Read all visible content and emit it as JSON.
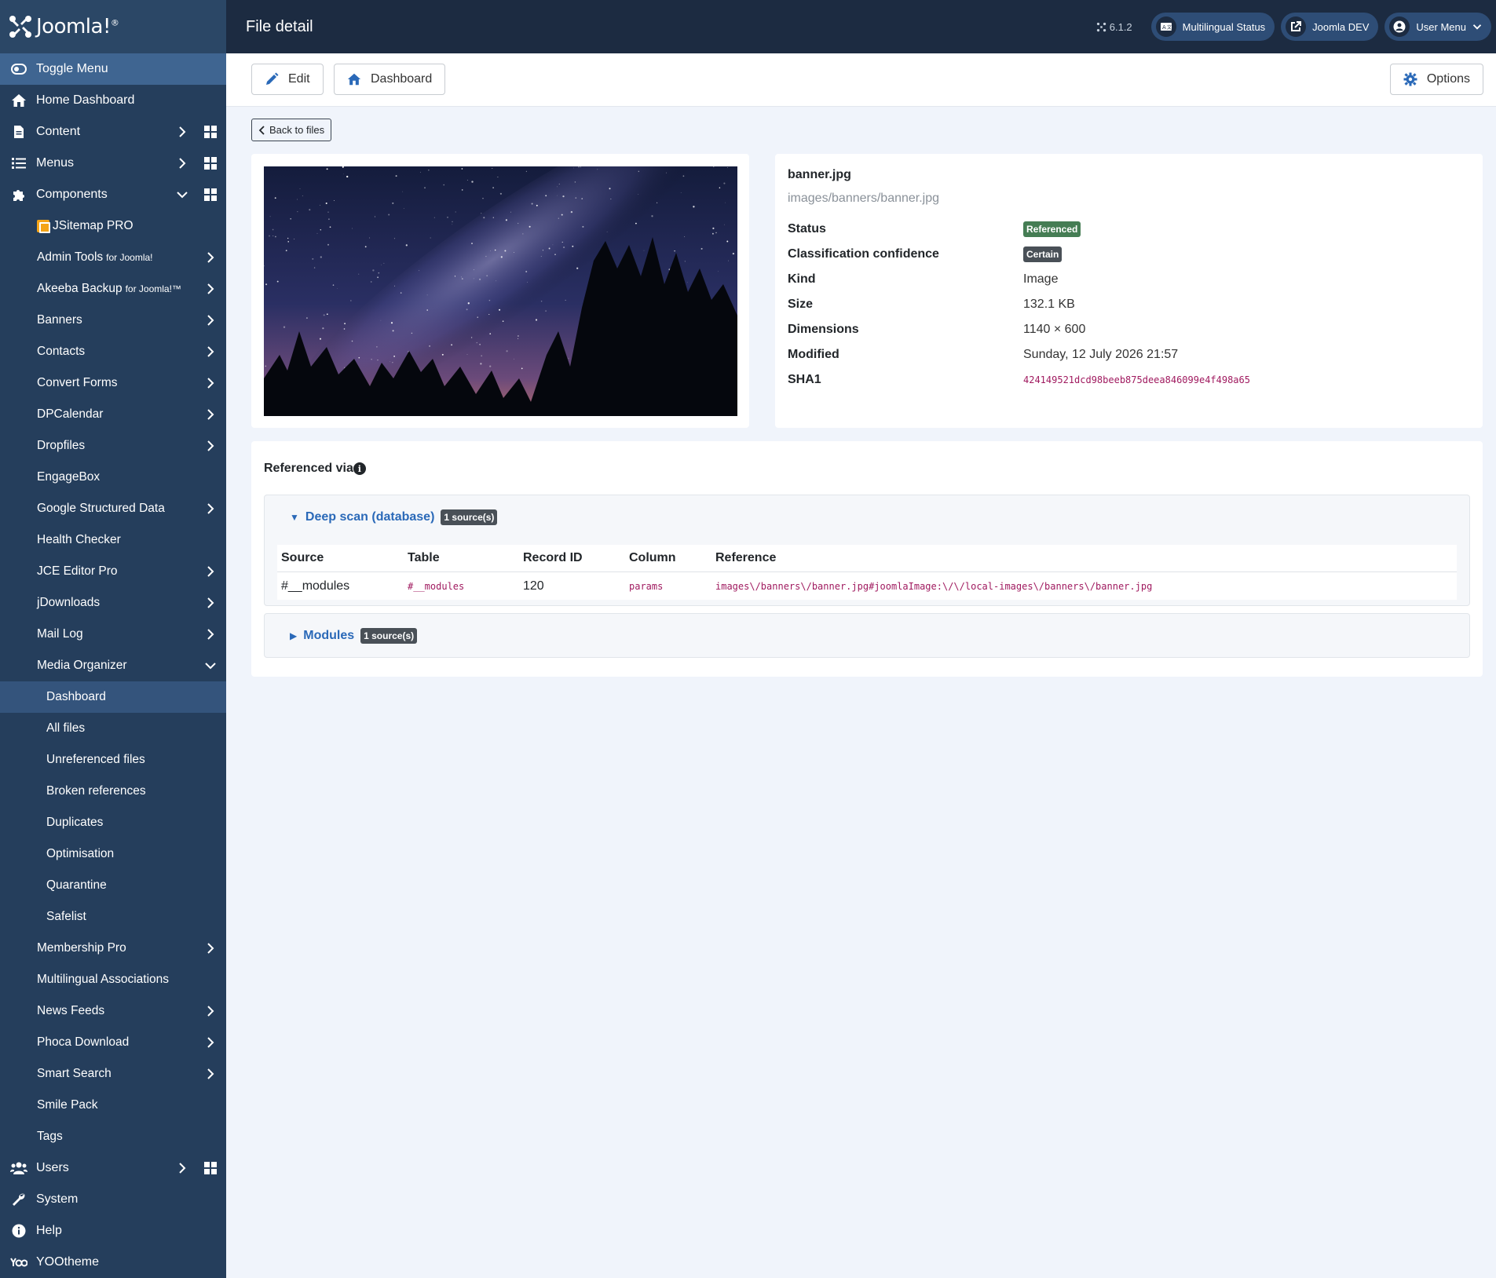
{
  "brand": {
    "name": "Joomla!"
  },
  "sidebar": {
    "toggle": "Toggle Menu",
    "items": [
      {
        "label": "Home Dashboard"
      },
      {
        "label": "Content"
      },
      {
        "label": "Menus"
      },
      {
        "label": "Components"
      }
    ],
    "components": [
      {
        "label": "JSitemap PRO"
      },
      {
        "label": "Admin Tools",
        "small": "for Joomla!"
      },
      {
        "label": "Akeeba Backup",
        "small": "for Joomla!™"
      },
      {
        "label": "Banners"
      },
      {
        "label": "Contacts"
      },
      {
        "label": "Convert Forms"
      },
      {
        "label": "DPCalendar"
      },
      {
        "label": "Dropfiles"
      },
      {
        "label": "EngageBox"
      },
      {
        "label": "Google Structured Data"
      },
      {
        "label": "Health Checker"
      },
      {
        "label": "JCE Editor Pro"
      },
      {
        "label": "jDownloads"
      },
      {
        "label": "Mail Log"
      },
      {
        "label": "Media Organizer"
      }
    ],
    "media_organizer": [
      {
        "label": "Dashboard"
      },
      {
        "label": "All files"
      },
      {
        "label": "Unreferenced files"
      },
      {
        "label": "Broken references"
      },
      {
        "label": "Duplicates"
      },
      {
        "label": "Optimisation"
      },
      {
        "label": "Quarantine"
      },
      {
        "label": "Safelist"
      }
    ],
    "components_more": [
      {
        "label": "Membership Pro"
      },
      {
        "label": "Multilingual Associations"
      },
      {
        "label": "News Feeds"
      },
      {
        "label": "Phoca Download"
      },
      {
        "label": "Smart Search"
      },
      {
        "label": "Smile Pack"
      },
      {
        "label": "Tags"
      }
    ],
    "bottom": [
      {
        "label": "Users"
      },
      {
        "label": "System"
      },
      {
        "label": "Help"
      },
      {
        "label": "YOOtheme"
      }
    ]
  },
  "header": {
    "title": "File detail",
    "version": "6.1.2",
    "multilingual": "Multilingual Status",
    "site": "Joomla DEV",
    "user_menu": "User Menu"
  },
  "toolbar": {
    "edit": "Edit",
    "dashboard": "Dashboard",
    "options": "Options"
  },
  "back_label": "Back to files",
  "file": {
    "name": "banner.jpg",
    "path": "images/banners/banner.jpg",
    "fields": [
      {
        "label": "Status",
        "value": "Referenced"
      },
      {
        "label": "Classification confidence",
        "value": "Certain"
      },
      {
        "label": "Kind",
        "value": "Image"
      },
      {
        "label": "Size",
        "value": "132.1 KB"
      },
      {
        "label": "Dimensions",
        "value": "1140 × 600"
      },
      {
        "label": "Modified",
        "value": "Sunday, 12 July 2026 21:57"
      },
      {
        "label": "SHA1",
        "value": "424149521dcd98beeb875deea846099e4f498a65"
      }
    ]
  },
  "references": {
    "title": "Referenced via",
    "info": "i",
    "groups": [
      {
        "name": "Deep scan (database)",
        "count": "1 source(s)",
        "expanded": true,
        "columns": [
          "Source",
          "Table",
          "Record ID",
          "Column",
          "Reference"
        ],
        "rows": [
          {
            "source": "#__modules",
            "table": "#__modules",
            "record_id": "120",
            "column": "params",
            "reference": "images\\/banners\\/banner.jpg#joomlaImage:\\/\\/local-images\\/banners\\/banner.jpg"
          }
        ]
      },
      {
        "name": "Modules",
        "count": "1 source(s)",
        "expanded": false
      }
    ]
  },
  "colors": {
    "sidebar": "#253e5c",
    "header": "#1c2b41",
    "accent": "#2a69b8",
    "badge_green": "#457d54",
    "mono_text": "#a01a5f"
  }
}
